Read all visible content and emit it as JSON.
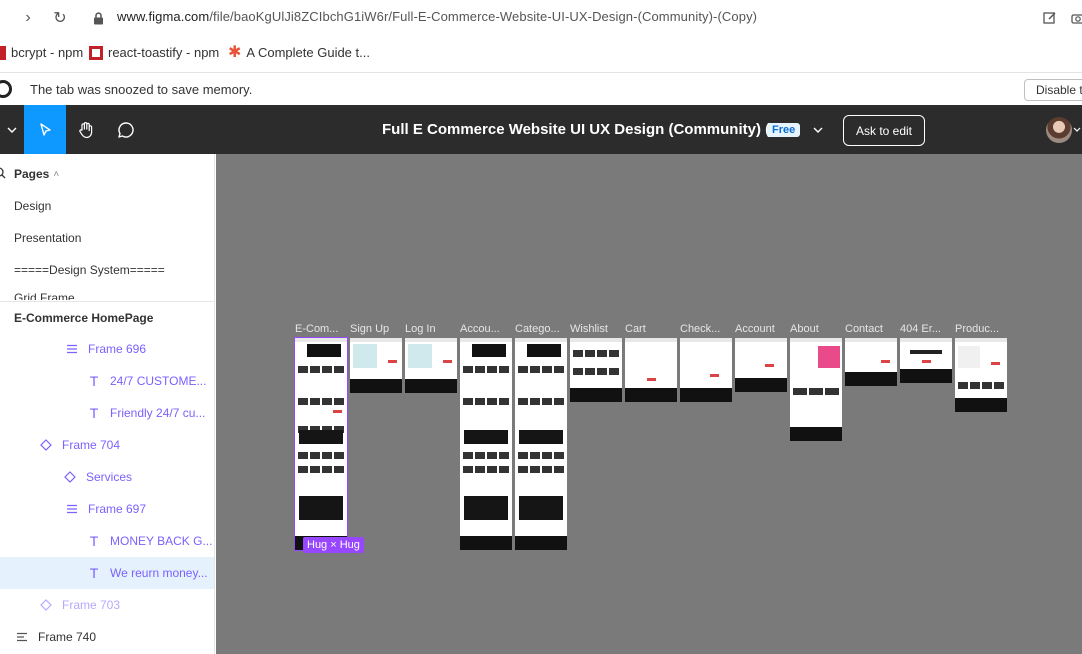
{
  "browser": {
    "url_host": "www.figma.com",
    "url_path": "/file/baoKgUlJi8ZCIbchG1iW6r/Full-E-Commerce-Website-UI-UX-Design-(Community)-(Copy)",
    "bookmarks": [
      {
        "label": "bcrypt - npm",
        "icon": "npm-icon"
      },
      {
        "label": "react-toastify - npm",
        "icon": "npm-icon"
      },
      {
        "label": "A Complete Guide t...",
        "icon": "asterisk-icon"
      }
    ],
    "snooze_message": "The tab was snoozed to save memory.",
    "disable_label": "Disable t"
  },
  "toolbar": {
    "title": "Full E Commerce Website UI UX Design (Community) (...",
    "plan_badge": "Free",
    "ask_label": "Ask to edit"
  },
  "sidebar": {
    "pages_label": "Pages",
    "pages": [
      "Design",
      "Presentation",
      "=====Design System=====",
      "Grid Frame"
    ],
    "current_page": "E-Commerce HomePage",
    "layers": [
      {
        "label": "Frame 696",
        "icon": "autolayout-icon"
      },
      {
        "label": "24/7 CUSTOME...",
        "icon": "text-icon"
      },
      {
        "label": "Friendly 24/7 cu...",
        "icon": "text-icon"
      },
      {
        "label": "Frame 704",
        "icon": "component-icon"
      },
      {
        "label": "Services",
        "icon": "component-icon"
      },
      {
        "label": "Frame 697",
        "icon": "autolayout-icon"
      },
      {
        "label": "MONEY BACK G...",
        "icon": "text-icon"
      },
      {
        "label": "We reurn money...",
        "icon": "text-icon"
      },
      {
        "label": "Frame 703",
        "icon": "component-icon"
      },
      {
        "label": "Frame 740",
        "icon": "autolayout-icon"
      }
    ]
  },
  "canvas": {
    "frames": [
      "E-Com...",
      "Sign Up",
      "Log In",
      "Accou...",
      "Catego...",
      "Wishlist",
      "Cart",
      "Check...",
      "Account",
      "About",
      "Contact",
      "404 Er...",
      "Produc..."
    ],
    "size_badge": "Hug × Hug",
    "accent_color": "#9747ff",
    "background_color": "#7a7a7a"
  }
}
